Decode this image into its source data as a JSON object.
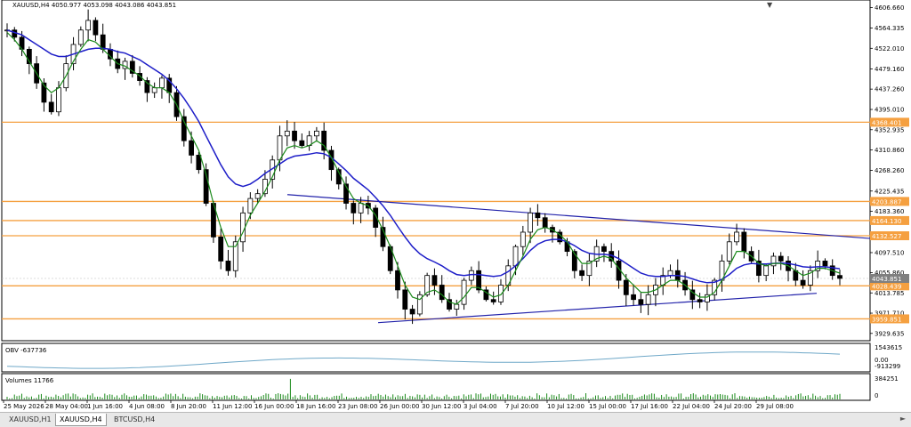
{
  "window": {
    "symbol_caption": "XAUUSD,H4  4050.977 4053.098 4043.086 4043.851",
    "close_glyph": "▼"
  },
  "tabs": [
    {
      "label": "XAUUSD,H1",
      "active": false
    },
    {
      "label": "XAUUSD,H4",
      "active": true
    },
    {
      "label": "BTCUSD,H4",
      "active": false
    }
  ],
  "scroll_glyph": "►",
  "colors": {
    "bull_bear": "#000000",
    "ma_slow": "#1e1ec8",
    "ma_fast": "#1a8a1a",
    "level_line": "#f5a040",
    "trend_line": "#2222aa",
    "obv_line": "#6fa8c8",
    "volume_bar": "#1a8a1a",
    "current_price_bg": "#808080"
  },
  "chart_data": {
    "type": "line",
    "price_axis": {
      "ticks": [
        4606.66,
        4564.335,
        4522.01,
        4479.16,
        4437.26,
        4395.01,
        4352.935,
        4310.86,
        4268.26,
        4225.435,
        4183.36,
        4097.51,
        4055.86,
        4013.785,
        3971.71,
        3929.635
      ],
      "range": [
        3920,
        4615
      ]
    },
    "time_axis": {
      "labels": [
        "25 May 2026",
        "28 May 04:00",
        "1 Jun 16:00",
        "4 Jun 08:00",
        "8 Jun 20:00",
        "11 Jun 12:00",
        "16 Jun 00:00",
        "18 Jun 16:00",
        "23 Jun 08:00",
        "26 Jun 00:00",
        "30 Jun 12:00",
        "3 Jul 04:00",
        "7 Jul 20:00",
        "10 Jul 12:00",
        "15 Jul 00:00",
        "17 Jul 16:00",
        "22 Jul 04:00",
        "24 Jul 20:00",
        "29 Jul 08:00"
      ]
    },
    "levels": [
      {
        "price": 4368.401,
        "label": "4368.401"
      },
      {
        "price": 4203.887,
        "label": "4203.887"
      },
      {
        "price": 4164.13,
        "label": "4164.130"
      },
      {
        "price": 4132.527,
        "label": "4132.527"
      },
      {
        "price": 4028.439,
        "label": "4028.439"
      },
      {
        "price": 3959.851,
        "label": "3959.851"
      }
    ],
    "current_price": {
      "price": 4043.851,
      "label": "4043.851"
    },
    "price_path": [
      4560,
      4545,
      4520,
      4490,
      4450,
      4410,
      4390,
      4440,
      4490,
      4530,
      4560,
      4580,
      4550,
      4520,
      4500,
      4480,
      4495,
      4470,
      4455,
      4430,
      4440,
      4460,
      4430,
      4380,
      4330,
      4300,
      4270,
      4200,
      4130,
      4080,
      4060,
      4120,
      4180,
      4210,
      4220,
      4250,
      4290,
      4340,
      4350,
      4330,
      4320,
      4340,
      4350,
      4310,
      4270,
      4240,
      4200,
      4180,
      4200,
      4190,
      4150,
      4110,
      4060,
      4020,
      3980,
      3970,
      4010,
      4050,
      4030,
      4000,
      3980,
      3990,
      4040,
      4060,
      4020,
      4000,
      3995,
      4030,
      4070,
      4110,
      4140,
      4180,
      4170,
      4150,
      4140,
      4120,
      4100,
      4060,
      4050,
      4080,
      4110,
      4100,
      4080,
      4040,
      4010,
      4000,
      3990,
      4010,
      4030,
      4050,
      4060,
      4040,
      4020,
      4000,
      3995,
      4010,
      4040,
      4080,
      4120,
      4140,
      4100,
      4080,
      4050,
      4070,
      4090,
      4080,
      4060,
      4040,
      4030,
      4060,
      4080,
      4070,
      4050,
      4044
    ],
    "ma_fast_path": [
      4555,
      4540,
      4520,
      4495,
      4470,
      4445,
      4430,
      4440,
      4465,
      4495,
      4520,
      4540,
      4535,
      4520,
      4505,
      4490,
      4485,
      4475,
      4465,
      4450,
      4440,
      4440,
      4430,
      4405,
      4370,
      4340,
      4310,
      4260,
      4200,
      4150,
      4110,
      4110,
      4140,
      4175,
      4200,
      4225,
      4255,
      4290,
      4315,
      4320,
      4315,
      4320,
      4330,
      4320,
      4295,
      4265,
      4235,
      4210,
      4200,
      4195,
      4175,
      4145,
      4110,
      4070,
      4030,
      4005,
      4000,
      4015,
      4020,
      4010,
      3995,
      3990,
      4005,
      4025,
      4025,
      4015,
      4005,
      4010,
      4030,
      4060,
      4090,
      4125,
      4145,
      4150,
      4145,
      4135,
      4120,
      4095,
      4075,
      4075,
      4085,
      4090,
      4085,
      4065,
      4045,
      4030,
      4015,
      4015,
      4020,
      4030,
      4040,
      4040,
      4030,
      4015,
      4005,
      4005,
      4015,
      4040,
      4070,
      4100,
      4100,
      4090,
      4075,
      4070,
      4075,
      4075,
      4070,
      4060,
      4050,
      4055,
      4065,
      4065,
      4060,
      4055
    ],
    "ma_slow_path": [
      4560,
      4555,
      4550,
      4540,
      4530,
      4520,
      4510,
      4505,
      4505,
      4510,
      4515,
      4520,
      4522,
      4522,
      4520,
      4515,
      4512,
      4505,
      4498,
      4488,
      4478,
      4468,
      4455,
      4438,
      4418,
      4395,
      4370,
      4340,
      4310,
      4280,
      4255,
      4240,
      4235,
      4240,
      4250,
      4262,
      4272,
      4282,
      4292,
      4298,
      4300,
      4302,
      4305,
      4303,
      4295,
      4282,
      4268,
      4252,
      4240,
      4228,
      4212,
      4195,
      4175,
      4152,
      4130,
      4110,
      4095,
      4085,
      4078,
      4070,
      4060,
      4052,
      4050,
      4052,
      4052,
      4050,
      4048,
      4050,
      4058,
      4070,
      4085,
      4102,
      4115,
      4122,
      4125,
      4125,
      4120,
      4112,
      4102,
      4096,
      4094,
      4094,
      4092,
      4085,
      4075,
      4065,
      4055,
      4050,
      4048,
      4048,
      4050,
      4050,
      4048,
      4043,
      4038,
      4035,
      4036,
      4042,
      4052,
      4065,
      4072,
      4075,
      4074,
      4074,
      4075,
      4076,
      4075,
      4072,
      4068,
      4067,
      4068,
      4068,
      4066,
      4064
    ],
    "trend_lines": [
      {
        "from": [
          0,
          4218
        ],
        "to": [
          1,
          4126
        ],
        "note": "upper"
      },
      {
        "from": [
          0,
          3952
        ],
        "to": [
          1,
          4013
        ],
        "note": "lower"
      }
    ],
    "indicators": [
      {
        "name": "OBV",
        "label": "OBV -637736",
        "axis_ticks": [
          "1543615",
          "0.00",
          "-913299"
        ]
      },
      {
        "name": "Volumes",
        "label": "Volumes 11766",
        "axis_ticks": [
          "384251",
          "0"
        ]
      }
    ]
  }
}
